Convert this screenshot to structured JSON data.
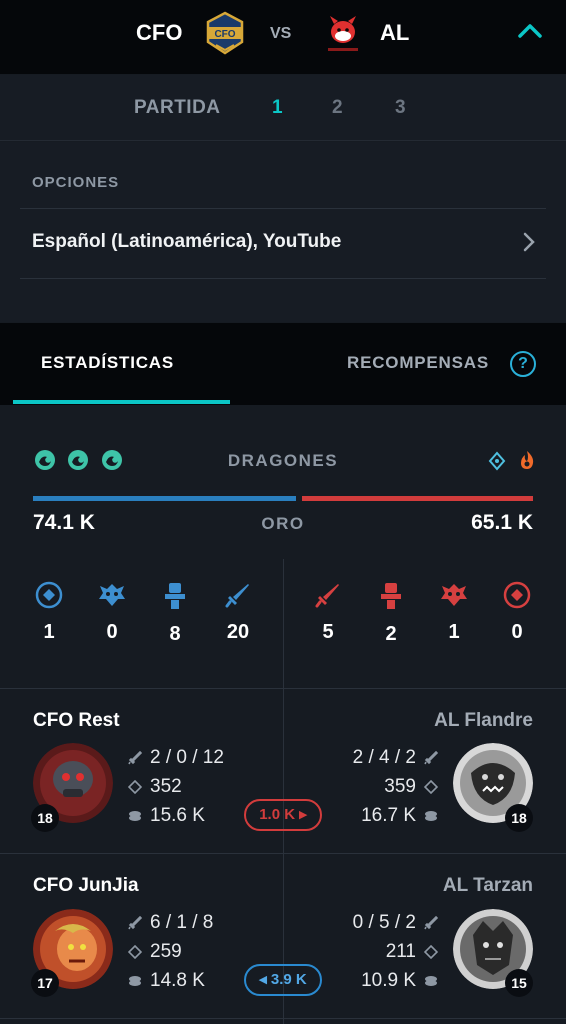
{
  "header": {
    "team_left": "CFO",
    "vs": "VS",
    "team_right": "AL"
  },
  "games": {
    "label": "PARTIDA",
    "items": [
      "1",
      "2",
      "3"
    ],
    "active": "1"
  },
  "options": {
    "title": "OPCIONES",
    "stream": "Español (Latinoamérica), YouTube"
  },
  "tabs": {
    "stats": "ESTADÍSTICAS",
    "rewards": "RECOMPENSAS",
    "help": "?"
  },
  "summary": {
    "dragons_label": "DRAGONES",
    "gold_label": "ORO",
    "gold_left": "74.1 K",
    "gold_right": "65.1 K",
    "gold_left_value": 74.1,
    "gold_right_value": 65.1,
    "left_dragon_icons": [
      "ocean-dragon-icon",
      "ocean-dragon-icon",
      "ocean-dragon-icon"
    ],
    "right_dragon_icons": [
      "hextech-dragon-icon",
      "infernal-dragon-icon"
    ]
  },
  "objectives": {
    "left": {
      "turrets_label": "1",
      "barons": "0",
      "inhibitors": "8",
      "kills": "20"
    },
    "right": {
      "kills": "5",
      "inhibitors": "2",
      "barons": "1",
      "turrets_label": "0"
    }
  },
  "players": [
    {
      "left_name": "CFO Rest",
      "left_kda": "2 / 0 / 12",
      "left_cs": "352",
      "left_gold": "15.6 K",
      "left_level": "18",
      "right_name": "AL Flandre",
      "right_kda": "2 / 4 / 2",
      "right_cs": "359",
      "right_gold": "16.7 K",
      "right_level": "18",
      "diff": "1.0 K ▸",
      "diff_side": "right"
    },
    {
      "left_name": "CFO JunJia",
      "left_kda": "6 / 1 / 8",
      "left_cs": "259",
      "left_gold": "14.8 K",
      "left_level": "17",
      "right_name": "AL Tarzan",
      "right_kda": "0 / 5 / 2",
      "right_cs": "211",
      "right_gold": "10.9 K",
      "right_level": "15",
      "diff": "◂ 3.9 K",
      "diff_side": "left"
    }
  ],
  "colors": {
    "accent": "#0bc6c6",
    "blue_team": "#2a7fbf",
    "red_team": "#d23c3c",
    "ocean_dragon": "#3ec4a8",
    "hextech_dragon": "#4fc0e0",
    "infernal_dragon": "#f06a2a"
  }
}
